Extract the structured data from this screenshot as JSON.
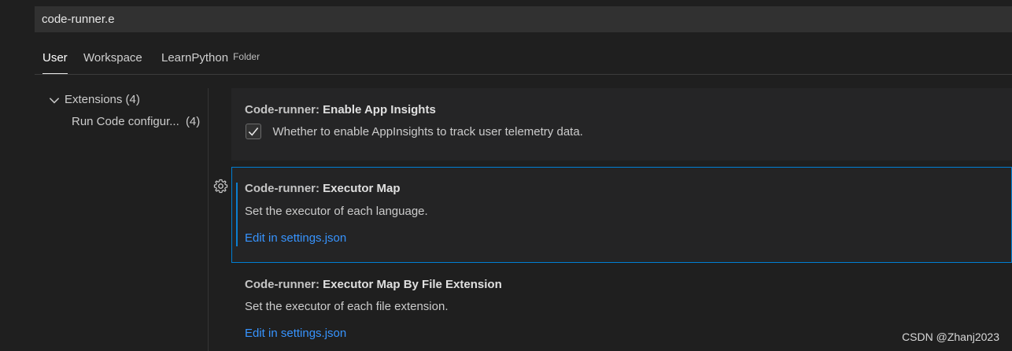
{
  "search": {
    "value": "code-runner.e"
  },
  "tabs": [
    {
      "label": "User",
      "active": true
    },
    {
      "label": "Workspace",
      "active": false
    },
    {
      "label": "LearnPython",
      "hint": "Folder",
      "active": false
    }
  ],
  "toc": {
    "group": {
      "label": "Extensions",
      "count": "(4)",
      "expanded": true
    },
    "items": [
      {
        "label": "Run Code configur...",
        "count": "(4)"
      }
    ]
  },
  "settings": [
    {
      "category": "Code-runner: ",
      "name": "Enable App Insights",
      "description": "Whether to enable AppInsights to track user telemetry data.",
      "checked": true
    },
    {
      "category": "Code-runner: ",
      "name": "Executor Map",
      "description": "Set the executor of each language.",
      "link": "Edit in settings.json",
      "focused": true
    },
    {
      "category": "Code-runner: ",
      "name": "Executor Map By File Extension",
      "description": "Set the executor of each file extension.",
      "link": "Edit in settings.json"
    }
  ],
  "icons": {
    "chevron": "chevron-down-icon",
    "gear": "gear-icon",
    "check": "check-icon"
  },
  "colors": {
    "accent": "#007fd4",
    "link": "#3794ff",
    "background": "#1f1f1f"
  },
  "watermark": "CSDN @Zhanj2023"
}
